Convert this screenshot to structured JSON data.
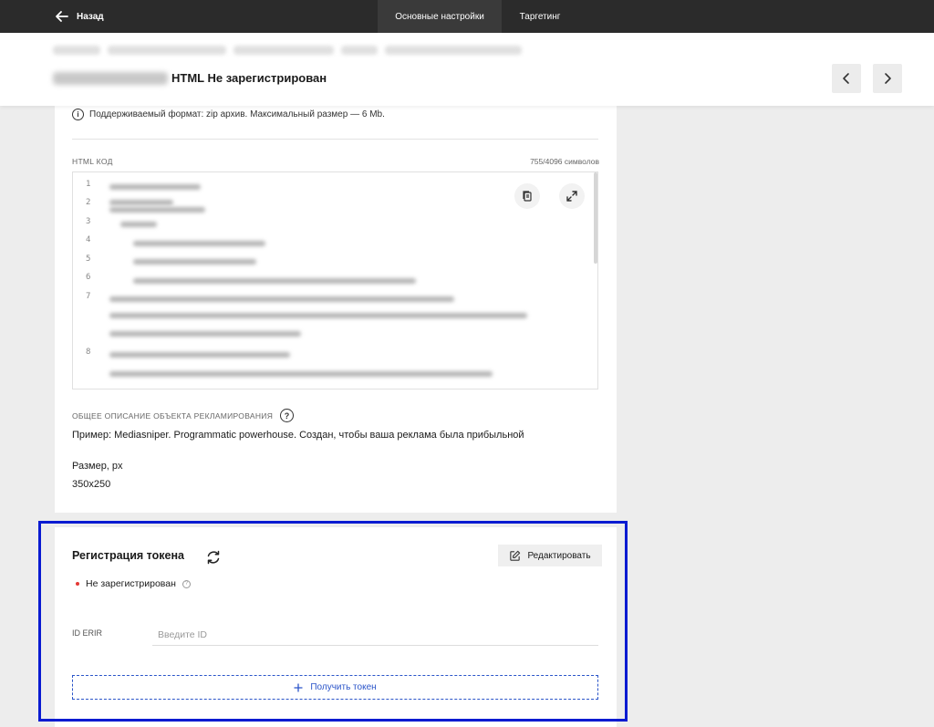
{
  "topbar": {
    "back_label": "Назад",
    "tabs": [
      {
        "label": "Основные настройки",
        "active": true
      },
      {
        "label": "Таргетинг",
        "active": false
      }
    ]
  },
  "header": {
    "title": "HTML Не зарегистрирован"
  },
  "main": {
    "info_text": "Поддерживаемый формат: zip архив. Максимальный размер — 6 Mb.",
    "code_label": "HTML КОД",
    "code_count": "755/4096 символов",
    "code_line_numbers": [
      "1",
      "2",
      "3",
      "4",
      "5",
      "6",
      "7",
      "8"
    ],
    "description_label": "ОБЩЕЕ ОПИСАНИЕ ОБЪЕКТА РЕКЛАМИРОВАНИЯ",
    "description_text": "Пример: Mediasniper. Programmatic powerhouse. Создан, чтобы ваша реклама была прибыльной",
    "size_label": "Размер, px",
    "size_value": "350x250"
  },
  "token": {
    "title": "Регистрация токена",
    "edit_label": "Редактировать",
    "status_text": "Не зарегистрирован",
    "erir_label": "ID ERIR",
    "erir_placeholder": "Введите ID",
    "get_token_label": "Получить токен"
  },
  "colors": {
    "topbar_bg": "#2b2b2b",
    "status_red": "#e53935",
    "accent_blue": "#2b55c9",
    "highlight_frame": "#0a1bd1"
  }
}
